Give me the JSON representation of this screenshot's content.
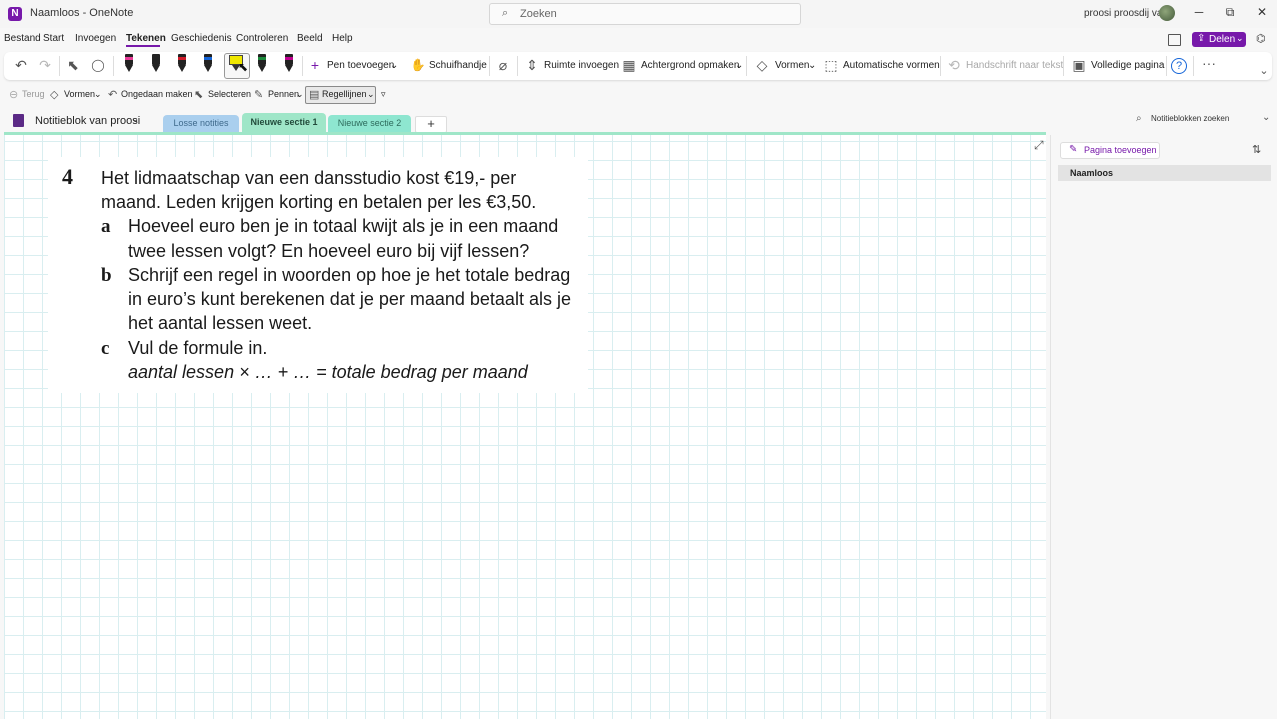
{
  "titlebar": {
    "app_icon": "onenote-icon",
    "title": "Naamloos  -  OneNote",
    "search_placeholder": "Zoeken",
    "user_name": "proosi proosdij van",
    "minimize": "─",
    "restore": "⧉",
    "close": "✕"
  },
  "menu": {
    "items": [
      "Bestand",
      "Start",
      "Invoegen",
      "Tekenen",
      "Geschiedenis",
      "Controleren",
      "Beeld",
      "Help"
    ],
    "active": "Tekenen",
    "share_label": "Delen"
  },
  "ribbon": {
    "icons": {
      "undo": "↶",
      "redo": "↷",
      "select": "⬉",
      "lasso": "◯",
      "pen_add": "+",
      "hand": "✋",
      "eraser": "⌀",
      "space": "⇕",
      "background": "▦",
      "shapes": "◇",
      "auto_shapes": "⬚",
      "handwriting": "⟲",
      "full_page": "▣",
      "help": "?",
      "more": "···",
      "collapse": "⌄"
    },
    "pen_add_label": "Pen toevoegen",
    "hand_label": "Schuifhandje",
    "space_label": "Ruimte invoegen",
    "background_label": "Achtergrond opmaken",
    "shapes_label": "Vormen",
    "auto_shapes_label": "Automatische vormen",
    "handwriting_label": "Handschrift naar tekst",
    "full_page_label": "Volledige pagina",
    "pen_colors": [
      "#e83a97",
      "#222222",
      "#d11b2a",
      "#1565d8",
      "#1b8a3b",
      "#c00090"
    ],
    "highlighter_color": "#f0e800"
  },
  "subbar": {
    "back_label": "Terug",
    "shapes_label": "Vormen",
    "undo_label": "Ongedaan maken",
    "select_label": "Selecteren",
    "pens_label": "Pennen",
    "ruled_label": "Regellijnen",
    "back_icon": "⊖",
    "shapes_icon": "◇",
    "undo_icon": "↶",
    "select_icon": "⬉",
    "pens_icon": "✎",
    "ruled_icon": "▤",
    "dropdown_icon": "⌄",
    "customize_icon": "▿"
  },
  "notebook": {
    "name": "Notitieblok van proosi",
    "chevron": "⌄",
    "tabs": [
      "Losse notities",
      "Nieuwe sectie 1",
      "Nieuwe sectie 2"
    ],
    "active_tab": "Nieuwe sectie 1",
    "add_tab": "+",
    "search_placeholder": "Notitieblokken zoeken",
    "search_icon": "⌕"
  },
  "content": {
    "number": "4",
    "intro_line1": "Het lidmaatschap van een dansstudio kost €19,- per",
    "intro_line2": "maand. Leden krijgen korting en betalen per les €3,50.",
    "a_label": "a",
    "a_line1": "Hoeveel euro ben je in totaal kwijt als je in een maand",
    "a_line2": "twee lessen volgt? En hoeveel euro bij vijf lessen?",
    "b_label": "b",
    "b_line1": "Schrijf een regel in woorden op hoe je het totale bedrag",
    "b_line2": "in euro’s kunt berekenen dat je per maand betaalt als je",
    "b_line3": "het aantal lessen weet.",
    "c_label": "c",
    "c_line1": "Vul de formule in.",
    "c_formula": "aantal lessen × … + … = totale bedrag per maand",
    "expand_icon": "⤢"
  },
  "pages": {
    "add_page_label": "Pagina toevoegen",
    "add_page_icon": "✎",
    "sort_icon": "⇅",
    "items": [
      "Naamloos"
    ]
  }
}
